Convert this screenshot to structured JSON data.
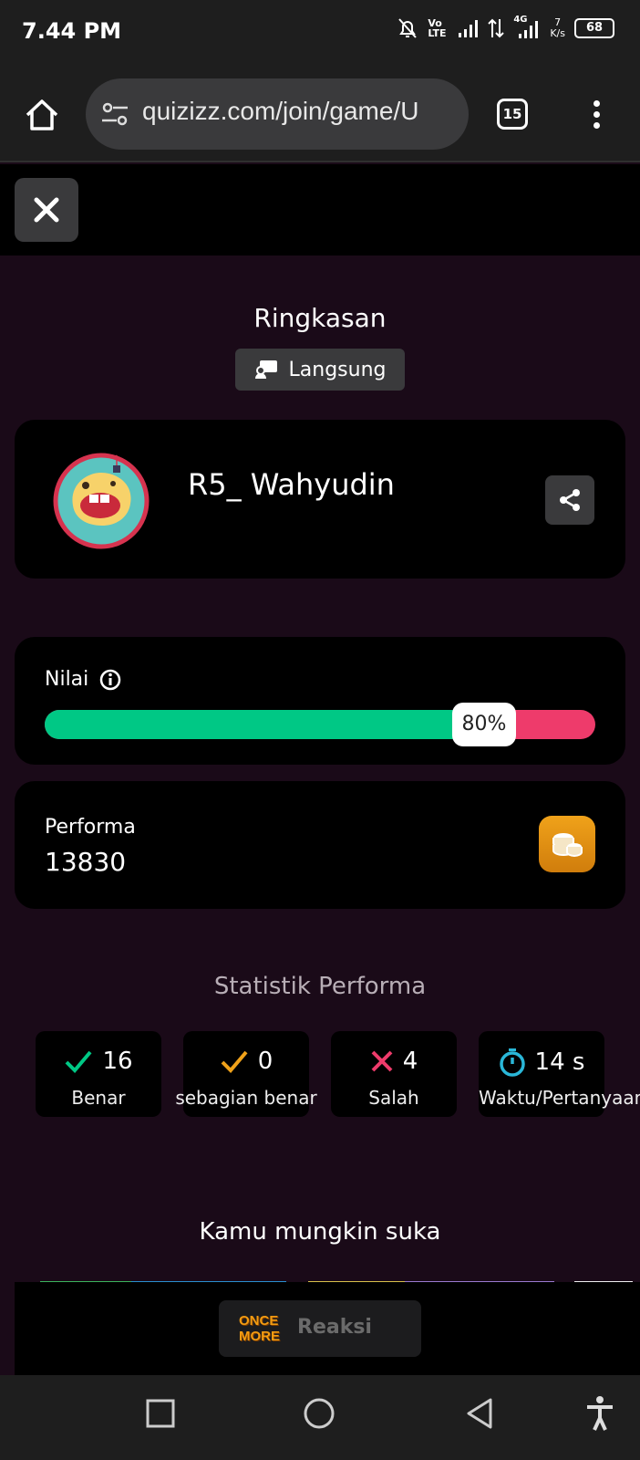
{
  "status_bar": {
    "time": "7.44 PM",
    "network_speed_value": "7",
    "network_speed_unit": "K/s",
    "battery": "68",
    "volte_label": "Vo LTE",
    "fourg_label": "4G"
  },
  "browser": {
    "url": "quizizz.com/join/game/U",
    "tab_count": "15"
  },
  "summary": {
    "title": "Ringkasan",
    "mode_label": "Langsung"
  },
  "player": {
    "name": "R5_ Wahyudin"
  },
  "score": {
    "label": "Nilai",
    "percent_text": "80%",
    "percent": 80,
    "fill_color": "#00c885",
    "remain_color": "#ee3b6b"
  },
  "performance": {
    "label": "Performa",
    "value": "13830"
  },
  "stats": {
    "title": "Statistik Performa",
    "items": [
      {
        "value": "16",
        "label": "Benar",
        "icon": "check-icon",
        "color": "#00c885"
      },
      {
        "value": "0",
        "label": "sebagian benar",
        "icon": "check-icon",
        "color": "#f0a21a"
      },
      {
        "value": "4",
        "label": "Salah",
        "icon": "cross-icon",
        "color": "#ee3b6b"
      },
      {
        "value": "14 s",
        "label": "Waktu/Pertanyaan",
        "icon": "stopwatch-icon",
        "color": "#2ab7d8"
      }
    ]
  },
  "suggestions": {
    "title": "Kamu mungkin suka"
  },
  "reaction": {
    "logo_text": "ONCE MORE",
    "label": "Reaksi"
  }
}
